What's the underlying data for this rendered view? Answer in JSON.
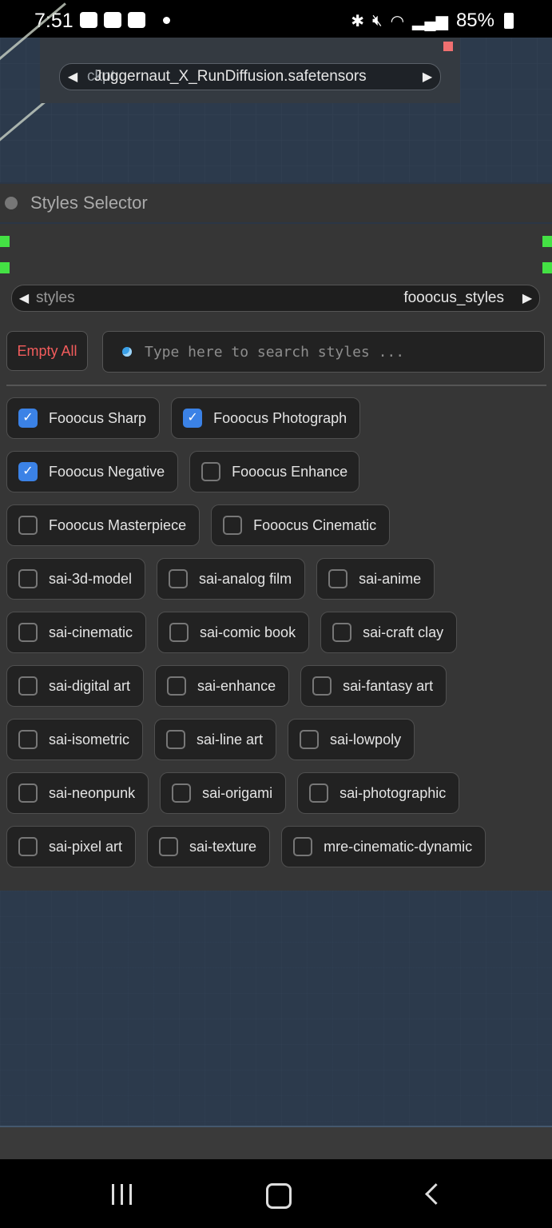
{
  "status_bar": {
    "time": "7:51",
    "battery": "85%"
  },
  "checkpoint_loader": {
    "label": "ckpt",
    "value": "Juggernaut_X_RunDiffusion.safetensors"
  },
  "styles_node": {
    "title": "Styles Selector",
    "styles_label": "styles",
    "styles_value": "fooocus_styles",
    "empty_all_label": "Empty All",
    "search_placeholder": "Type here to search styles ...",
    "styles": [
      {
        "label": "Fooocus Sharp",
        "checked": true
      },
      {
        "label": "Fooocus Photograph",
        "checked": true
      },
      {
        "label": "Fooocus Negative",
        "checked": true
      },
      {
        "label": "Fooocus Enhance",
        "checked": false
      },
      {
        "label": "Fooocus Masterpiece",
        "checked": false
      },
      {
        "label": "Fooocus Cinematic",
        "checked": false
      },
      {
        "label": "sai-3d-model",
        "checked": false
      },
      {
        "label": "sai-analog film",
        "checked": false
      },
      {
        "label": "sai-anime",
        "checked": false
      },
      {
        "label": "sai-cinematic",
        "checked": false
      },
      {
        "label": "sai-comic book",
        "checked": false
      },
      {
        "label": "sai-craft clay",
        "checked": false
      },
      {
        "label": "sai-digital art",
        "checked": false
      },
      {
        "label": "sai-enhance",
        "checked": false
      },
      {
        "label": "sai-fantasy art",
        "checked": false
      },
      {
        "label": "sai-isometric",
        "checked": false
      },
      {
        "label": "sai-line art",
        "checked": false
      },
      {
        "label": "sai-lowpoly",
        "checked": false
      },
      {
        "label": "sai-neonpunk",
        "checked": false
      },
      {
        "label": "sai-origami",
        "checked": false
      },
      {
        "label": "sai-photographic",
        "checked": false
      },
      {
        "label": "sai-pixel art",
        "checked": false
      },
      {
        "label": "sai-texture",
        "checked": false
      },
      {
        "label": "mre-cinematic-dynamic",
        "checked": false
      }
    ]
  },
  "colors": {
    "checkbox_on": "#3b82e6",
    "empty_all_text": "#f25c5c",
    "anchor_green": "#44e144"
  }
}
